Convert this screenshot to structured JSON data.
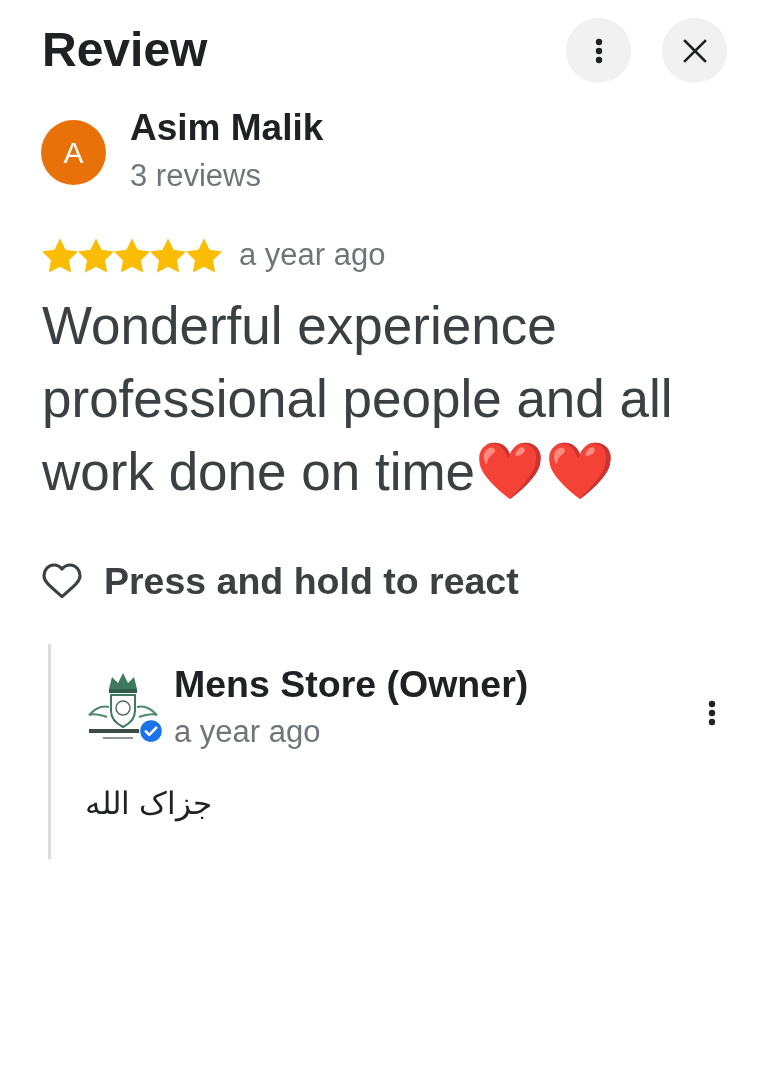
{
  "header": {
    "title": "Review"
  },
  "review": {
    "author": {
      "initial": "A",
      "name": "Asim Malik",
      "reviews_count": "3 reviews"
    },
    "stars": 5,
    "time": "a year ago",
    "text": "Wonderful experience professional people and all work done on time❤️❤️"
  },
  "react": {
    "label": "Press and hold to react"
  },
  "owner_reply": {
    "name": "Mens Store (Owner)",
    "verified": true,
    "time": "a year ago",
    "text": "جزاک الله"
  }
}
